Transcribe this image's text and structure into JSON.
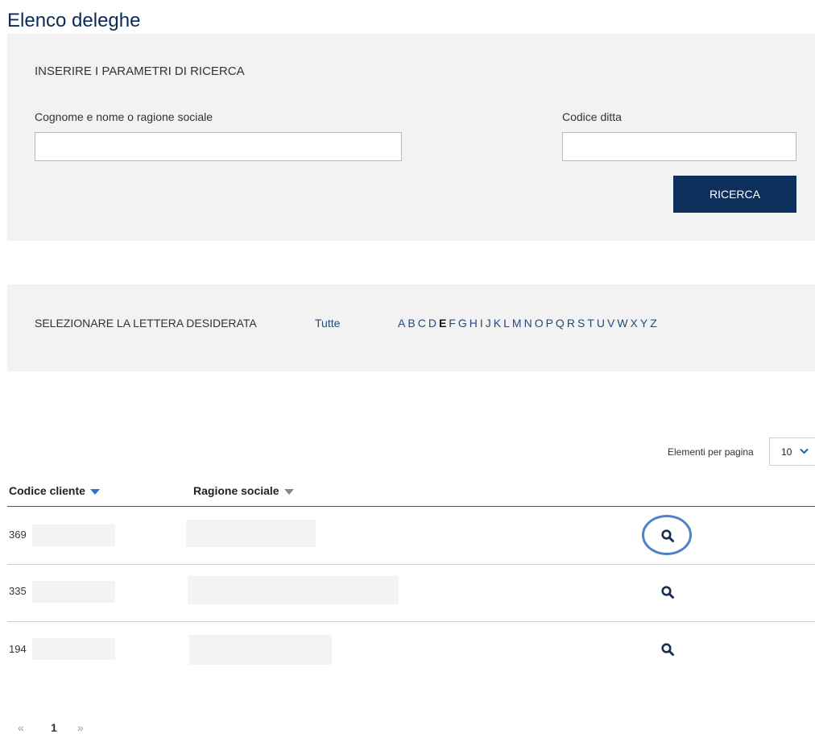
{
  "page": {
    "title": "Elenco deleghe"
  },
  "search": {
    "heading": "INSERIRE I PARAMETRI DI RICERCA",
    "name_label": "Cognome e nome o ragione sociale",
    "name_value": "",
    "code_label": "Codice ditta",
    "code_value": "",
    "button_label": "RICERCA"
  },
  "letters": {
    "label": "SELEZIONARE LA LETTERA DESIDERATA",
    "all_label": "Tutte",
    "items": [
      "A",
      "B",
      "C",
      "D",
      "E",
      "F",
      "G",
      "H",
      "I",
      "J",
      "K",
      "L",
      "M",
      "N",
      "O",
      "P",
      "Q",
      "R",
      "S",
      "T",
      "U",
      "V",
      "W",
      "X",
      "Y",
      "Z"
    ],
    "active": "E"
  },
  "table": {
    "per_page_label": "Elementi per pagina",
    "per_page_value": "10",
    "columns": [
      "Codice cliente",
      "Ragione sociale"
    ],
    "rows": [
      {
        "code": "369"
      },
      {
        "code": "335"
      },
      {
        "code": "194"
      }
    ]
  },
  "pagination": {
    "prev": "«",
    "current": "1",
    "next": "»"
  },
  "colors": {
    "accent": "#0d2f5c",
    "link": "#1f4a7e",
    "highlight_circle": "#4f82c4"
  },
  "icons": {
    "row_action": "magnifier-icon",
    "sort": "triangle-down-icon",
    "select": "chevron-down-icon"
  }
}
